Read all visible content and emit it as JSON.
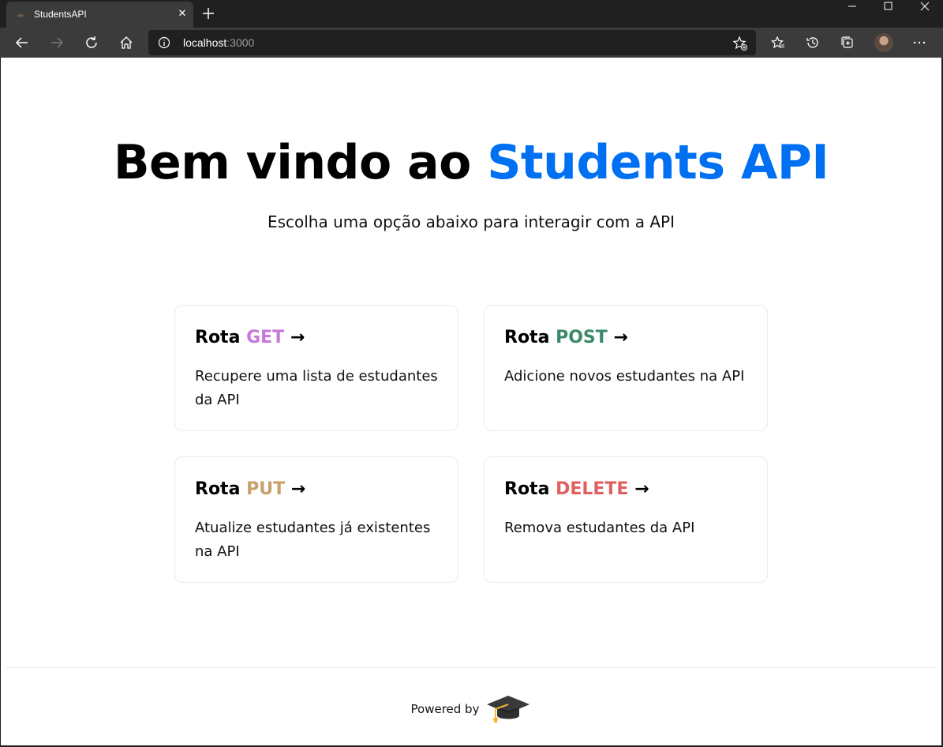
{
  "browser": {
    "tab_title": "StudentsAPI",
    "tab_close": "✕",
    "address_host": "localhost",
    "address_port": ":3000"
  },
  "hero": {
    "title_prefix": "Bem vindo ao ",
    "title_accent": "Students API",
    "subtitle": "Escolha uma opção abaixo para interagir com a API"
  },
  "cards": [
    {
      "prefix": "Rota ",
      "method": "GET",
      "arrow": " →",
      "method_color": "#c678dd",
      "description": "Recupere uma lista de estudantes da API"
    },
    {
      "prefix": "Rota ",
      "method": "POST",
      "arrow": " →",
      "method_color": "#3a8a6a",
      "description": "Adicione novos estudantes na API"
    },
    {
      "prefix": "Rota ",
      "method": "PUT",
      "arrow": " →",
      "method_color": "#c8a06a",
      "description": "Atualize estudantes já existentes na API"
    },
    {
      "prefix": "Rota ",
      "method": "DELETE",
      "arrow": " →",
      "method_color": "#e06060",
      "description": "Remova estudantes da API"
    }
  ],
  "footer": {
    "powered_by": "Powered by",
    "logo_icon": "graduation-cap-icon"
  },
  "colors": {
    "accent": "#0070f3"
  }
}
